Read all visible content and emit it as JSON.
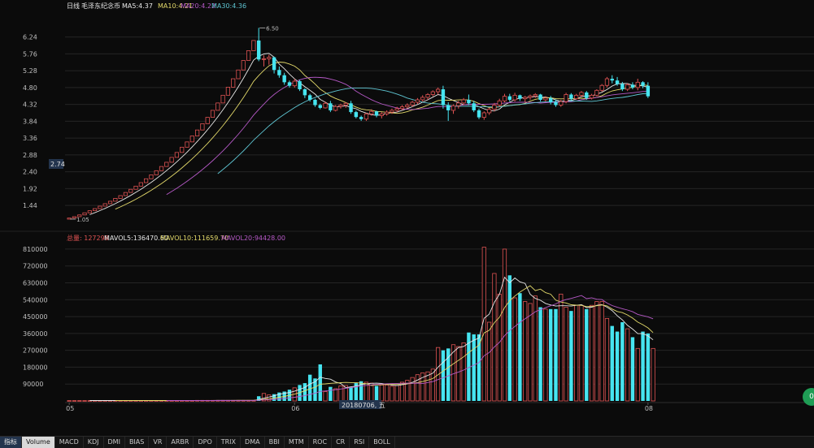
{
  "price_legend": {
    "period": "日线",
    "name": "毛泽东纪念币",
    "ma5": "MA5:4.37",
    "ma10": "MA10:4.21",
    "ma20": "MA20:4.22",
    "ma30": "MA30:4.36"
  },
  "volume_legend": {
    "total": "总量: 127298",
    "mavol5": "MAVOL5:136470.60",
    "mavol10": "MAVOL10:111659.70",
    "mavol20": "MAVOL20:94428.00"
  },
  "tabs": [
    "指标",
    "Volume",
    "MACD",
    "KDJ",
    "DMI",
    "BIAS",
    "VR",
    "ARBR",
    "DPO",
    "TRIX",
    "DMA",
    "BBI",
    "MTM",
    "ROC",
    "CR",
    "RSI",
    "BOLL"
  ],
  "active_tab": "Volume",
  "fab_label": "0",
  "colors": {
    "background": "#0b0b0b",
    "up": "#e05353",
    "down": "#46e4f0",
    "ma5": "#e8e8e8",
    "ma10": "#e3d96a",
    "ma20": "#b659c7",
    "ma30": "#5fc6d3",
    "grid": "#252525"
  },
  "chart_data": [
    {
      "type": "candlestick",
      "title": "日线 毛泽东纪念币",
      "ylim": [
        1.05,
        6.6
      ],
      "y_ticks": [
        "6.24",
        "5.76",
        "5.28",
        "4.80",
        "4.32",
        "3.84",
        "3.36",
        "2.88",
        "2.40",
        "1.92",
        "1.44"
      ],
      "x_ticks": [
        "05",
        "06",
        "08"
      ],
      "current_price_label": "2.74",
      "max_label": "6.50",
      "min_label": "1.05",
      "crosshair_date": "20180706, 五",
      "ohlc": [
        [
          1.05,
          1.08,
          1.05,
          1.08
        ],
        [
          1.08,
          1.12,
          1.08,
          1.12
        ],
        [
          1.12,
          1.17,
          1.12,
          1.17
        ],
        [
          1.17,
          1.23,
          1.17,
          1.23
        ],
        [
          1.23,
          1.29,
          1.23,
          1.29
        ],
        [
          1.29,
          1.35,
          1.29,
          1.35
        ],
        [
          1.35,
          1.42,
          1.35,
          1.42
        ],
        [
          1.42,
          1.49,
          1.42,
          1.49
        ],
        [
          1.49,
          1.56,
          1.49,
          1.56
        ],
        [
          1.56,
          1.64,
          1.56,
          1.64
        ],
        [
          1.64,
          1.72,
          1.64,
          1.72
        ],
        [
          1.72,
          1.81,
          1.72,
          1.81
        ],
        [
          1.81,
          1.9,
          1.81,
          1.9
        ],
        [
          1.9,
          1.99,
          1.9,
          1.99
        ],
        [
          1.99,
          2.09,
          1.99,
          2.09
        ],
        [
          2.09,
          2.2,
          2.09,
          2.2
        ],
        [
          2.2,
          2.31,
          2.2,
          2.31
        ],
        [
          2.31,
          2.43,
          2.31,
          2.43
        ],
        [
          2.43,
          2.55,
          2.43,
          2.55
        ],
        [
          2.55,
          2.67,
          2.55,
          2.67
        ],
        [
          2.67,
          2.81,
          2.67,
          2.81
        ],
        [
          2.81,
          2.95,
          2.81,
          2.95
        ],
        [
          2.95,
          3.1,
          2.95,
          3.1
        ],
        [
          3.1,
          3.25,
          3.1,
          3.25
        ],
        [
          3.25,
          3.42,
          3.25,
          3.42
        ],
        [
          3.42,
          3.59,
          3.42,
          3.59
        ],
        [
          3.59,
          3.77,
          3.59,
          3.77
        ],
        [
          3.77,
          3.95,
          3.77,
          3.95
        ],
        [
          3.95,
          4.15,
          3.95,
          4.15
        ],
        [
          4.15,
          4.36,
          4.15,
          4.36
        ],
        [
          4.36,
          4.58,
          4.36,
          4.58
        ],
        [
          4.58,
          4.81,
          4.58,
          4.81
        ],
        [
          4.81,
          5.05,
          4.81,
          5.05
        ],
        [
          5.05,
          5.3,
          5.05,
          5.3
        ],
        [
          5.3,
          5.57,
          5.3,
          5.57
        ],
        [
          5.57,
          5.85,
          5.57,
          5.85
        ],
        [
          5.85,
          6.14,
          5.85,
          6.14
        ],
        [
          6.14,
          6.5,
          5.55,
          5.6
        ],
        [
          5.6,
          5.72,
          5.4,
          5.62
        ],
        [
          5.62,
          5.74,
          5.45,
          5.66
        ],
        [
          5.66,
          5.68,
          5.2,
          5.3
        ],
        [
          5.3,
          5.4,
          5.08,
          5.15
        ],
        [
          5.15,
          5.22,
          4.88,
          4.95
        ],
        [
          4.95,
          5.0,
          4.8,
          4.85
        ],
        [
          4.85,
          5.05,
          4.8,
          4.98
        ],
        [
          4.98,
          5.02,
          4.7,
          4.75
        ],
        [
          4.75,
          4.78,
          4.5,
          4.58
        ],
        [
          4.58,
          4.62,
          4.4,
          4.45
        ],
        [
          4.45,
          4.48,
          4.25,
          4.3
        ],
        [
          4.3,
          4.34,
          4.18,
          4.22
        ],
        [
          4.22,
          4.4,
          4.2,
          4.35
        ],
        [
          4.35,
          4.42,
          4.1,
          4.15
        ],
        [
          4.15,
          4.3,
          4.12,
          4.26
        ],
        [
          4.26,
          4.34,
          4.2,
          4.3
        ],
        [
          4.3,
          4.38,
          4.22,
          4.35
        ],
        [
          4.35,
          4.42,
          4.05,
          4.1
        ],
        [
          4.1,
          4.14,
          3.92,
          3.96
        ],
        [
          3.96,
          4.0,
          3.85,
          3.9
        ],
        [
          3.9,
          4.08,
          3.85,
          4.05
        ],
        [
          4.05,
          4.18,
          4.0,
          4.12
        ],
        [
          4.12,
          4.14,
          3.95,
          4.0
        ],
        [
          4.0,
          4.1,
          3.92,
          4.05
        ],
        [
          4.05,
          4.15,
          4.0,
          4.1
        ],
        [
          4.1,
          4.2,
          4.05,
          4.15
        ],
        [
          4.15,
          4.25,
          4.1,
          4.2
        ],
        [
          4.2,
          4.3,
          4.15,
          4.25
        ],
        [
          4.25,
          4.35,
          4.2,
          4.3
        ],
        [
          4.3,
          4.42,
          4.25,
          4.38
        ],
        [
          4.38,
          4.5,
          4.33,
          4.45
        ],
        [
          4.45,
          4.58,
          4.4,
          4.52
        ],
        [
          4.52,
          4.64,
          4.45,
          4.6
        ],
        [
          4.6,
          4.72,
          4.55,
          4.68
        ],
        [
          4.68,
          4.8,
          4.6,
          4.75
        ],
        [
          4.75,
          4.85,
          4.2,
          4.3
        ],
        [
          4.3,
          4.38,
          3.85,
          4.15
        ],
        [
          4.15,
          4.32,
          4.05,
          4.28
        ],
        [
          4.28,
          4.42,
          4.2,
          4.36
        ],
        [
          4.36,
          4.5,
          4.3,
          4.45
        ],
        [
          4.45,
          4.6,
          4.3,
          4.35
        ],
        [
          4.35,
          4.42,
          4.1,
          4.15
        ],
        [
          4.15,
          4.2,
          3.9,
          3.95
        ],
        [
          3.95,
          4.12,
          3.88,
          4.08
        ],
        [
          4.08,
          4.22,
          4.02,
          4.18
        ],
        [
          4.18,
          4.36,
          4.12,
          4.3
        ],
        [
          4.3,
          4.48,
          4.25,
          4.42
        ],
        [
          4.42,
          4.62,
          4.38,
          4.55
        ],
        [
          4.55,
          4.62,
          4.4,
          4.45
        ],
        [
          4.45,
          4.65,
          4.4,
          4.58
        ],
        [
          4.58,
          4.6,
          4.42,
          4.48
        ],
        [
          4.48,
          4.56,
          4.38,
          4.52
        ],
        [
          4.52,
          4.6,
          4.45,
          4.56
        ],
        [
          4.56,
          4.64,
          4.5,
          4.6
        ],
        [
          4.6,
          4.62,
          4.4,
          4.45
        ],
        [
          4.45,
          4.55,
          4.4,
          4.5
        ],
        [
          4.5,
          4.56,
          4.32,
          4.38
        ],
        [
          4.38,
          4.46,
          4.25,
          4.3
        ],
        [
          4.3,
          4.45,
          4.25,
          4.4
        ],
        [
          4.4,
          4.65,
          4.35,
          4.6
        ],
        [
          4.6,
          4.64,
          4.42,
          4.48
        ],
        [
          4.48,
          4.62,
          4.45,
          4.58
        ],
        [
          4.58,
          4.7,
          4.52,
          4.66
        ],
        [
          4.66,
          4.7,
          4.45,
          4.5
        ],
        [
          4.5,
          4.62,
          4.46,
          4.58
        ],
        [
          4.58,
          4.75,
          4.55,
          4.72
        ],
        [
          4.72,
          4.9,
          4.68,
          4.86
        ],
        [
          4.86,
          5.1,
          4.8,
          5.05
        ],
        [
          5.05,
          5.15,
          4.92,
          5.0
        ],
        [
          5.0,
          5.1,
          4.85,
          4.9
        ],
        [
          4.9,
          4.96,
          4.7,
          4.75
        ],
        [
          4.75,
          4.92,
          4.7,
          4.88
        ],
        [
          4.88,
          4.95,
          4.75,
          4.8
        ],
        [
          4.8,
          5.05,
          4.72,
          4.95
        ],
        [
          4.95,
          4.98,
          4.78,
          4.85
        ],
        [
          4.85,
          4.95,
          4.5,
          4.55
        ]
      ],
      "ma_series": [
        "MA5",
        "MA10",
        "MA20",
        "MA30"
      ]
    },
    {
      "type": "bar",
      "title": "总量",
      "ylim": [
        0,
        840000
      ],
      "y_ticks": [
        "810000",
        "720000",
        "630000",
        "540000",
        "450000",
        "360000",
        "270000",
        "180000",
        "90000"
      ],
      "values": [
        2000,
        2000,
        2000,
        2000,
        2000,
        2000,
        2000,
        2000,
        2000,
        2000,
        2000,
        2000,
        2000,
        2000,
        2000,
        2000,
        2000,
        2000,
        2000,
        2000,
        2000,
        2000,
        2000,
        2000,
        2000,
        3000,
        3000,
        3000,
        3000,
        3000,
        3000,
        3000,
        3000,
        3000,
        3000,
        3000,
        3000,
        25000,
        40000,
        32000,
        36000,
        45000,
        50000,
        60000,
        70000,
        85000,
        95000,
        140000,
        120000,
        195000,
        50000,
        75000,
        65000,
        80000,
        82000,
        75000,
        95000,
        105000,
        100000,
        95000,
        80000,
        85000,
        85000,
        78000,
        82000,
        100000,
        110000,
        125000,
        140000,
        150000,
        155000,
        170000,
        285000,
        270000,
        280000,
        300000,
        290000,
        310000,
        365000,
        355000,
        355000,
        820000,
        420000,
        680000,
        570000,
        810000,
        670000,
        550000,
        575000,
        530000,
        520000,
        560000,
        500000,
        490000,
        490000,
        490000,
        570000,
        500000,
        480000,
        510000,
        510000,
        490000,
        510000,
        530000,
        530000,
        440000,
        400000,
        370000,
        420000,
        385000,
        340000,
        280000,
        370000,
        360000,
        280000
      ],
      "series": [
        {
          "name": "MAVOL5"
        },
        {
          "name": "MAVOL10"
        },
        {
          "name": "MAVOL20"
        }
      ]
    }
  ]
}
